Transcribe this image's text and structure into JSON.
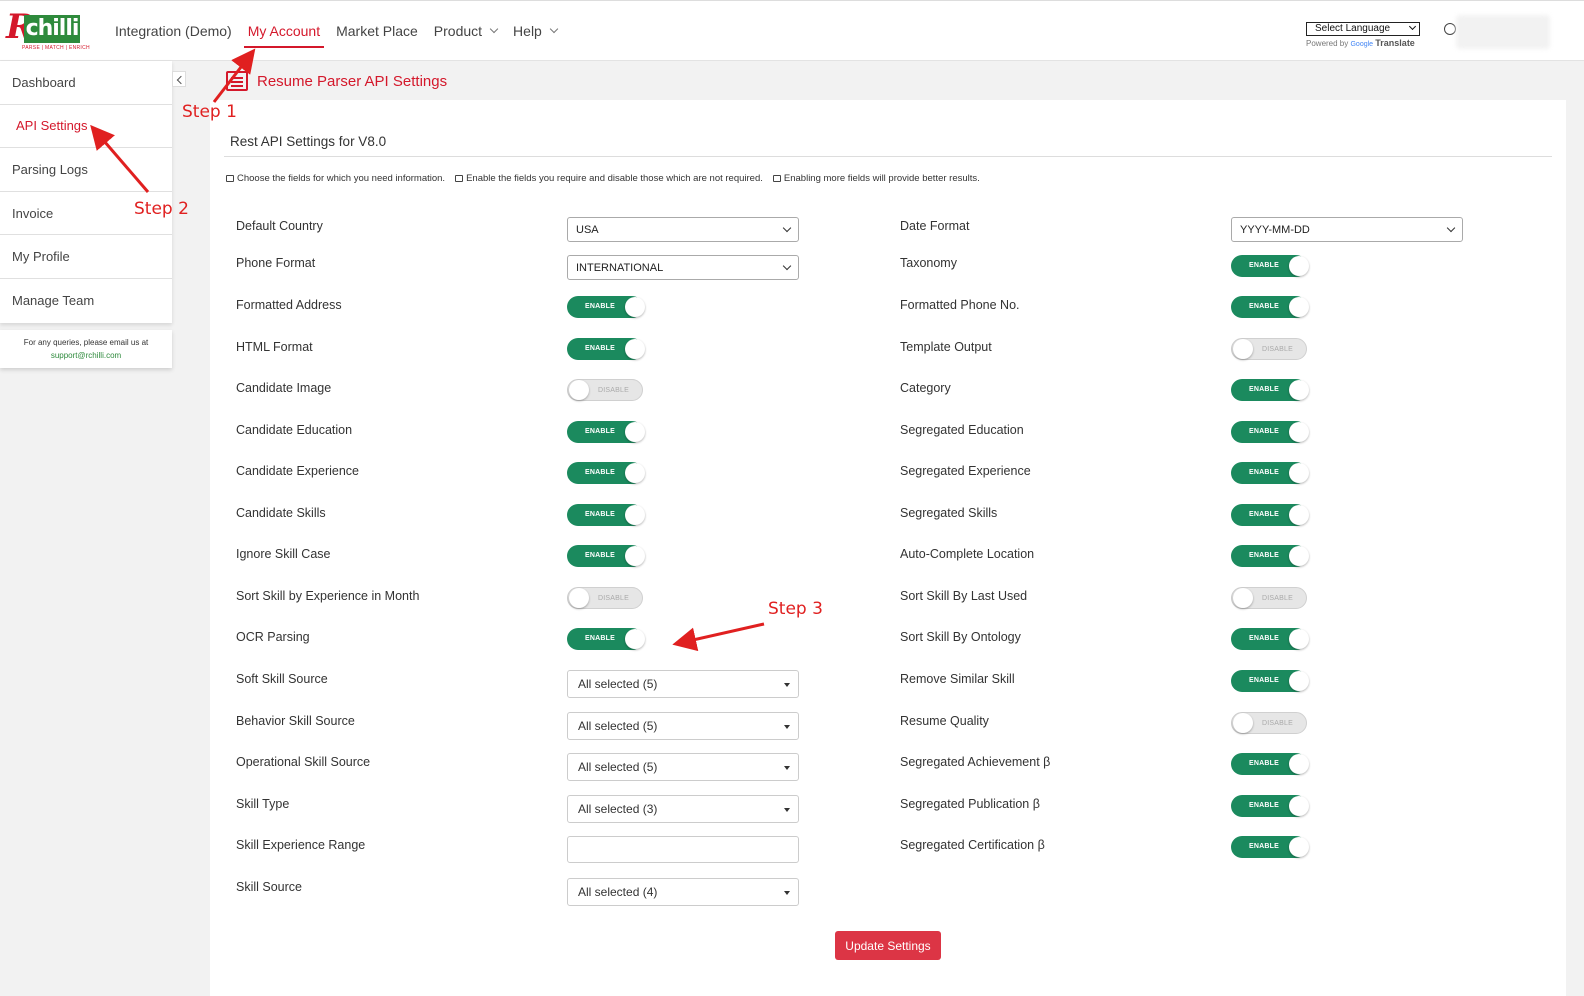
{
  "header": {
    "logo_text": "chilli",
    "logo_r": "R",
    "logo_tagline": "PARSE | MATCH | ENRICH",
    "nav": [
      {
        "label": "Integration (Demo)"
      },
      {
        "label": "My Account"
      },
      {
        "label": "Market Place"
      },
      {
        "label": "Product"
      },
      {
        "label": "Help"
      }
    ],
    "language_select": "Select Language",
    "powered_prefix": "Powered by",
    "powered_google": "Google",
    "powered_translate": "Translate"
  },
  "sidebar": {
    "items": [
      {
        "label": "Dashboard"
      },
      {
        "label": "API Settings"
      },
      {
        "label": "Parsing Logs"
      },
      {
        "label": "Invoice"
      },
      {
        "label": "My Profile"
      },
      {
        "label": "Manage Team"
      }
    ],
    "support_text": "For any queries, please email us at",
    "support_email": "support@rchilli.com"
  },
  "page": {
    "title": "Resume Parser API Settings",
    "section_title": "Rest API Settings for V8.0",
    "hints": [
      "Choose the fields for which you need information.",
      "Enable the fields you require and disable those which are not required.",
      "Enabling more fields will provide better results."
    ]
  },
  "left_fields": {
    "default_country": {
      "label": "Default Country",
      "value": "USA"
    },
    "phone_format": {
      "label": "Phone Format",
      "value": "INTERNATIONAL"
    },
    "formatted_address": {
      "label": "Formatted Address",
      "state": "ENABLE"
    },
    "html_format": {
      "label": "HTML Format",
      "state": "ENABLE"
    },
    "candidate_image": {
      "label": "Candidate Image",
      "state": "DISABLE"
    },
    "candidate_education": {
      "label": "Candidate Education",
      "state": "ENABLE"
    },
    "candidate_experience": {
      "label": "Candidate Experience",
      "state": "ENABLE"
    },
    "candidate_skills": {
      "label": "Candidate Skills",
      "state": "ENABLE"
    },
    "ignore_skill_case": {
      "label": "Ignore Skill Case",
      "state": "ENABLE"
    },
    "sort_skill_experience": {
      "label": "Sort Skill by Experience in Month",
      "state": "DISABLE"
    },
    "ocr_parsing": {
      "label": "OCR Parsing",
      "state": "ENABLE"
    },
    "soft_skill_source": {
      "label": "Soft Skill Source",
      "value": "All selected (5)"
    },
    "behavior_skill_source": {
      "label": "Behavior Skill Source",
      "value": "All selected (5)"
    },
    "operational_skill_source": {
      "label": "Operational Skill Source",
      "value": "All selected (5)"
    },
    "skill_type": {
      "label": "Skill Type",
      "value": "All selected (3)"
    },
    "skill_experience_range": {
      "label": "Skill Experience Range",
      "value": ""
    },
    "skill_source": {
      "label": "Skill Source",
      "value": "All selected (4)"
    }
  },
  "right_fields": {
    "date_format": {
      "label": "Date Format",
      "value": "YYYY-MM-DD"
    },
    "taxonomy": {
      "label": "Taxonomy",
      "state": "ENABLE"
    },
    "formatted_phone": {
      "label": "Formatted Phone No.",
      "state": "ENABLE"
    },
    "template_output": {
      "label": "Template Output",
      "state": "DISABLE"
    },
    "category": {
      "label": "Category",
      "state": "ENABLE"
    },
    "segregated_education": {
      "label": "Segregated Education",
      "state": "ENABLE"
    },
    "segregated_experience": {
      "label": "Segregated Experience",
      "state": "ENABLE"
    },
    "segregated_skills": {
      "label": "Segregated Skills",
      "state": "ENABLE"
    },
    "auto_complete_location": {
      "label": "Auto-Complete Location",
      "state": "ENABLE"
    },
    "sort_skill_last_used": {
      "label": "Sort Skill By Last Used",
      "state": "DISABLE"
    },
    "sort_skill_ontology": {
      "label": "Sort Skill By Ontology",
      "state": "ENABLE"
    },
    "remove_similar_skill": {
      "label": "Remove Similar Skill",
      "state": "ENABLE"
    },
    "resume_quality": {
      "label": "Resume Quality",
      "state": "DISABLE"
    },
    "segregated_achievement": {
      "label": "Segregated Achievement β",
      "state": "ENABLE"
    },
    "segregated_publication": {
      "label": "Segregated Publication β",
      "state": "ENABLE"
    },
    "segregated_certification": {
      "label": "Segregated Certification β",
      "state": "ENABLE"
    }
  },
  "update_button": "Update Settings",
  "annotations": {
    "step1": "Step 1",
    "step2": "Step 2",
    "step3": "Step 3"
  },
  "colors": {
    "brand_red": "#d4182b",
    "brand_green": "#2e8a3c",
    "toggle_on": "#1b8a5e",
    "button_red": "#dc3545",
    "annotation_red": "#e02020"
  }
}
